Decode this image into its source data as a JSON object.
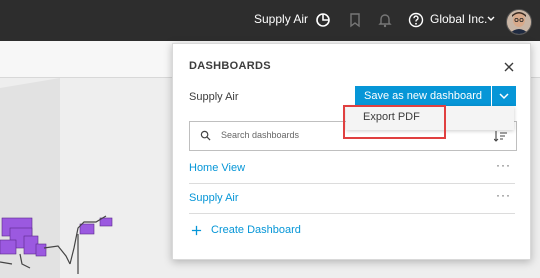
{
  "header": {
    "page_name": "Supply Air",
    "account": "Global Inc."
  },
  "panel": {
    "title": "DASHBOARDS",
    "current_dashboard": "Supply Air",
    "save_button": "Save as new dashboard",
    "search_placeholder": "Search dashboards",
    "items": [
      {
        "label": "Home View",
        "more": "···"
      },
      {
        "label": "Supply Air",
        "more": "···"
      }
    ],
    "create_label": "Create Dashboard"
  },
  "menu": {
    "export_label": "Export PDF"
  },
  "colors": {
    "accent": "#0696d7",
    "topbar": "#2d2d2d",
    "highlight": "#e04040",
    "model": "#9b59e0"
  }
}
